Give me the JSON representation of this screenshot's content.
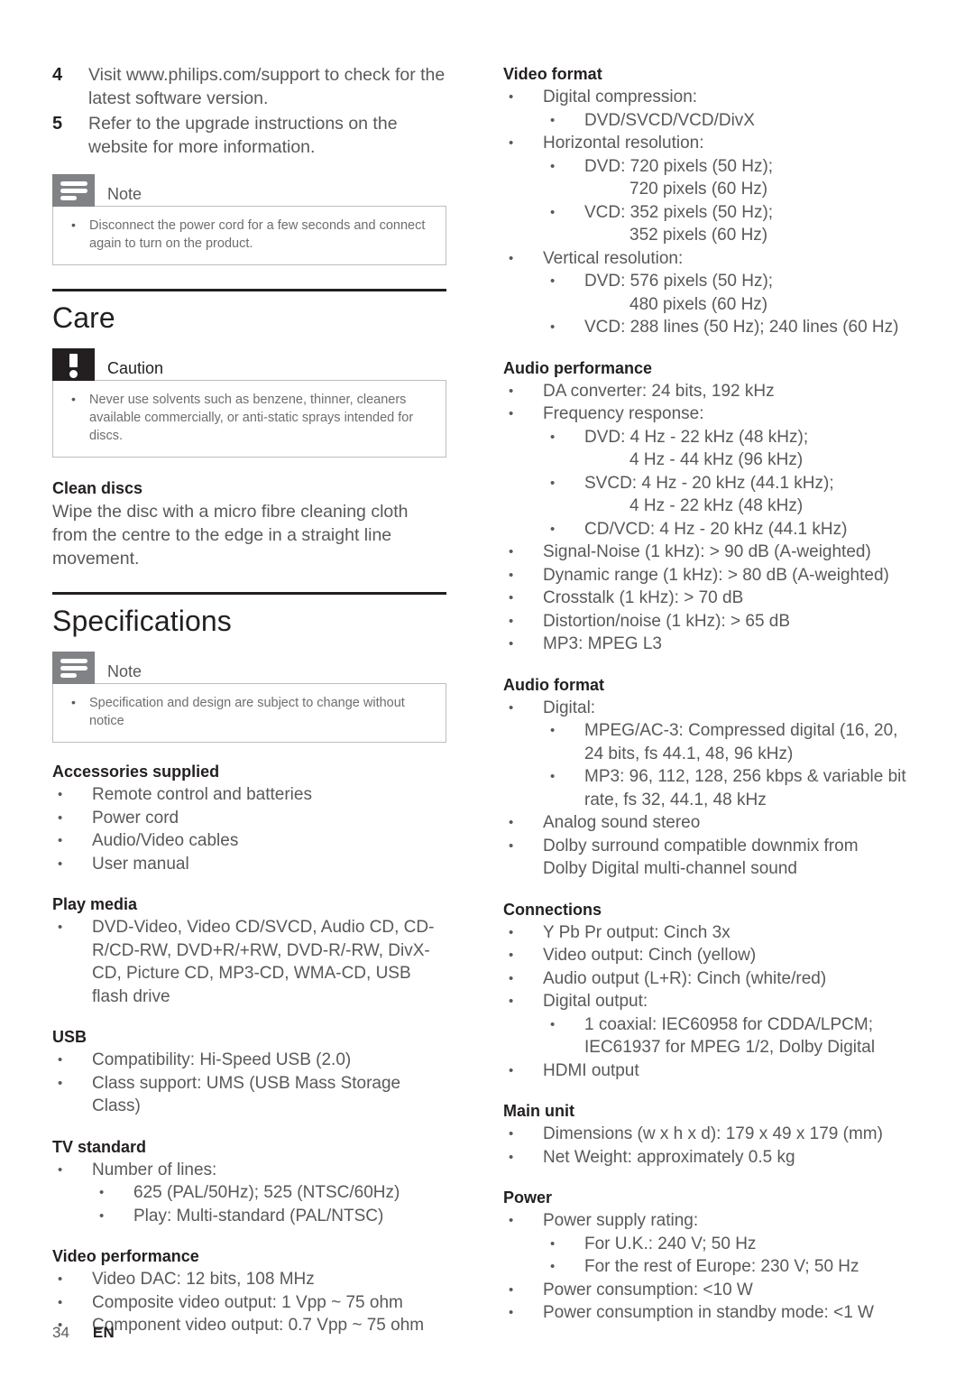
{
  "page": {
    "footer_page_number": "34",
    "footer_language": "EN"
  },
  "left_column": {
    "steps": [
      {
        "num": "4",
        "text": "Visit www.philips.com/support to check for the latest software version."
      },
      {
        "num": "5",
        "text": "Refer to the upgrade instructions on the website for more information."
      }
    ],
    "note_top": {
      "icon": "note-icon",
      "title": "Note",
      "items": [
        "Disconnect the power cord for a few seconds and connect again to turn on the product."
      ]
    },
    "care": {
      "heading": "Care",
      "caution": {
        "icon": "caution-icon",
        "title": "Caution",
        "items": [
          "Never use solvents such as benzene, thinner, cleaners available commercially, or anti-static sprays intended for discs."
        ]
      },
      "clean_discs": {
        "heading": "Clean discs",
        "text": "Wipe the disc with a micro fibre cleaning cloth from the centre to the edge in a straight line movement."
      }
    },
    "specifications": {
      "heading": "Specifications",
      "note": {
        "icon": "note-icon",
        "title": "Note",
        "items": [
          "Specification and design are subject to change without notice"
        ]
      },
      "accessories_supplied": {
        "heading": "Accessories supplied",
        "items": [
          "Remote control and batteries",
          "Power cord",
          "Audio/Video cables",
          "User manual"
        ]
      },
      "play_media": {
        "heading": "Play media",
        "items": [
          "DVD-Video, Video CD/SVCD, Audio CD, CD-R/CD-RW, DVD+R/+RW, DVD-R/-RW, DivX-CD, Picture CD, MP3-CD, WMA-CD, USB flash drive"
        ]
      },
      "usb": {
        "heading": "USB",
        "items": [
          "Compatibility: Hi-Speed USB (2.0)",
          "Class support: UMS (USB Mass Storage Class)"
        ]
      },
      "tv_standard": {
        "heading": "TV standard",
        "item": "Number of lines:",
        "subitems": [
          "625 (PAL/50Hz); 525 (NTSC/60Hz)",
          "Play: Multi-standard (PAL/NTSC)"
        ]
      },
      "video_performance": {
        "heading": "Video performance",
        "items": [
          "Video DAC: 12 bits, 108 MHz",
          "Composite video output: 1 Vpp ~ 75 ohm",
          "Component video output: 0.7 Vpp ~ 75 ohm"
        ]
      }
    }
  },
  "right_column": {
    "video_format": {
      "heading": "Video format",
      "digital_compression_label": "Digital compression:",
      "digital_compression_value": "DVD/SVCD/VCD/DivX",
      "horizontal_label": "Horizontal resolution:",
      "horizontal_dvd": "DVD: 720 pixels (50 Hz);",
      "horizontal_dvd_cont": "720 pixels (60 Hz)",
      "horizontal_vcd": "VCD: 352 pixels (50 Hz);",
      "horizontal_vcd_cont": "352 pixels (60 Hz)",
      "vertical_label": "Vertical resolution:",
      "vertical_dvd": "DVD: 576 pixels (50 Hz);",
      "vertical_dvd_cont": "480 pixels (60 Hz)",
      "vertical_vcd": "VCD: 288 lines (50 Hz); 240 lines (60 Hz)"
    },
    "audio_performance": {
      "heading": "Audio performance",
      "da_converter": "DA converter: 24 bits, 192 kHz",
      "frequency_response_label": "Frequency response:",
      "fr_dvd": "DVD: 4 Hz - 22 kHz (48 kHz);",
      "fr_dvd_cont": "4 Hz - 44 kHz (96 kHz)",
      "fr_svcd": "SVCD: 4 Hz - 20 kHz (44.1 kHz);",
      "fr_svcd_cont": "4 Hz - 22 kHz (48 kHz)",
      "fr_cdvcd": "CD/VCD: 4 Hz - 20 kHz (44.1 kHz)",
      "signal_noise": "Signal-Noise (1 kHz): > 90 dB (A-weighted)",
      "dynamic_range": "Dynamic range (1 kHz): > 80 dB (A-weighted)",
      "crosstalk": "Crosstalk (1 kHz): > 70 dB",
      "distortion": "Distortion/noise (1 kHz): > 65 dB",
      "mp3": "MP3: MPEG L3"
    },
    "audio_format": {
      "heading": "Audio format",
      "digital_label": "Digital:",
      "mpeg_ac3": "MPEG/AC-3: Compressed digital (16, 20, 24 bits, fs 44.1, 48, 96 kHz)",
      "mp3": "MP3: 96, 112, 128, 256 kbps & variable bit rate, fs 32, 44.1, 48 kHz",
      "analog": "Analog sound stereo",
      "dolby": "Dolby surround compatible downmix from Dolby Digital multi-channel sound"
    },
    "connections": {
      "heading": "Connections",
      "ypbpr": "Y Pb Pr output: Cinch 3x",
      "video_output": "Video output: Cinch (yellow)",
      "audio_output": "Audio output (L+R): Cinch (white/red)",
      "digital_output_label": "Digital output:",
      "coaxial": "1 coaxial: IEC60958 for CDDA/LPCM;",
      "coaxial_cont": "IEC61937 for MPEG 1/2, Dolby Digital",
      "hdmi": "HDMI output"
    },
    "main_unit": {
      "heading": "Main unit",
      "dimensions": "Dimensions (w x h x d): 179 x 49 x 179 (mm)",
      "weight": "Net Weight: approximately 0.5 kg"
    },
    "power": {
      "heading": "Power",
      "supply_rating_label": "Power supply rating:",
      "uk": "For U.K.: 240 V; 50 Hz",
      "europe": "For the rest of Europe: 230 V; 50 Hz",
      "consumption": "Power consumption: <10 W",
      "standby": "Power consumption in standby mode: <1 W"
    }
  }
}
